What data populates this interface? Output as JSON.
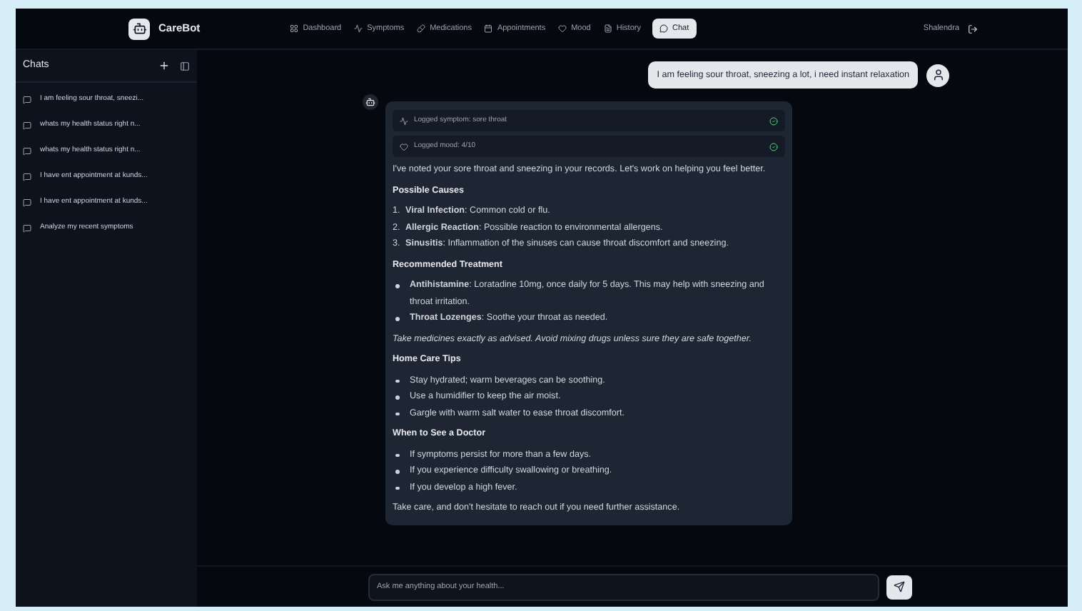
{
  "header": {
    "brand": "CareBot",
    "nav": [
      {
        "label": "Dashboard",
        "selected": false
      },
      {
        "label": "Symptoms",
        "selected": false
      },
      {
        "label": "Medications",
        "selected": false
      },
      {
        "label": "Appointments",
        "selected": false
      },
      {
        "label": "Mood",
        "selected": false
      },
      {
        "label": "History",
        "selected": false
      },
      {
        "label": "Chat",
        "selected": true
      }
    ],
    "user": "Shalendra"
  },
  "sidebar": {
    "title": "Chats",
    "items": [
      {
        "label": "I am feeling sour throat, sneezi..."
      },
      {
        "label": "whats my health status right n..."
      },
      {
        "label": "whats my health status right n..."
      },
      {
        "label": "I have ent appointment at kunds..."
      },
      {
        "label": "I have ent appointment at kunds..."
      },
      {
        "label": "Analyze my recent symptoms"
      }
    ]
  },
  "messages": [
    {
      "kind": "user",
      "text": "I am feeling sour throat, sneezing a lot, i need instant relaxation"
    },
    {
      "kind": "bot",
      "tools": [
        {
          "label": "Logged symptom: sore throat",
          "done": true
        },
        {
          "label": "Logged mood: 4/10",
          "done": true
        }
      ],
      "blocks": [
        {
          "kind": "paragraph",
          "text": "I've noted your sore throat and sneezing in your records. Let's work on helping you feel better."
        },
        {
          "kind": "heading",
          "text": "Possible Causes"
        },
        {
          "kind": "numbered",
          "items": [
            {
              "number": "1.",
              "text": "**Viral Infection**: Common cold or flu."
            },
            {
              "number": "2.",
              "text": "**Allergic Reaction**: Possible reaction to environmental allergens."
            },
            {
              "number": "3.",
              "text": "**Sinusitis**: Inflammation of the sinuses can cause throat discomfort and sneezing."
            }
          ]
        },
        {
          "kind": "heading",
          "text": "Recommended Treatment"
        },
        {
          "kind": "bullets",
          "items": [
            "**Antihistamine**: Loratadine 10mg, once daily for 5 days. This may help with sneezing and throat irritation.",
            "**Throat Lozenges**: Soothe your throat as needed."
          ]
        },
        {
          "kind": "note",
          "text": "Take medicines exactly as advised. Avoid mixing drugs unless sure they are safe together."
        },
        {
          "kind": "heading",
          "text": "Home Care Tips"
        },
        {
          "kind": "bullets",
          "items": [
            "Stay hydrated; warm beverages can be soothing.",
            "Use a humidifier to keep the air moist.",
            "Gargle with warm salt water to ease throat discomfort."
          ]
        },
        {
          "kind": "heading",
          "text": "When to See a Doctor"
        },
        {
          "kind": "bullets",
          "items": [
            "If symptoms persist for more than a few days.",
            "If you experience difficulty swallowing or breathing.",
            "If you develop a high fever."
          ]
        },
        {
          "kind": "paragraph",
          "text": "Take care, and don't hesitate to reach out if you need further assistance."
        }
      ]
    }
  ],
  "composer": {
    "placeholder": "Ask me anything about your health..."
  }
}
